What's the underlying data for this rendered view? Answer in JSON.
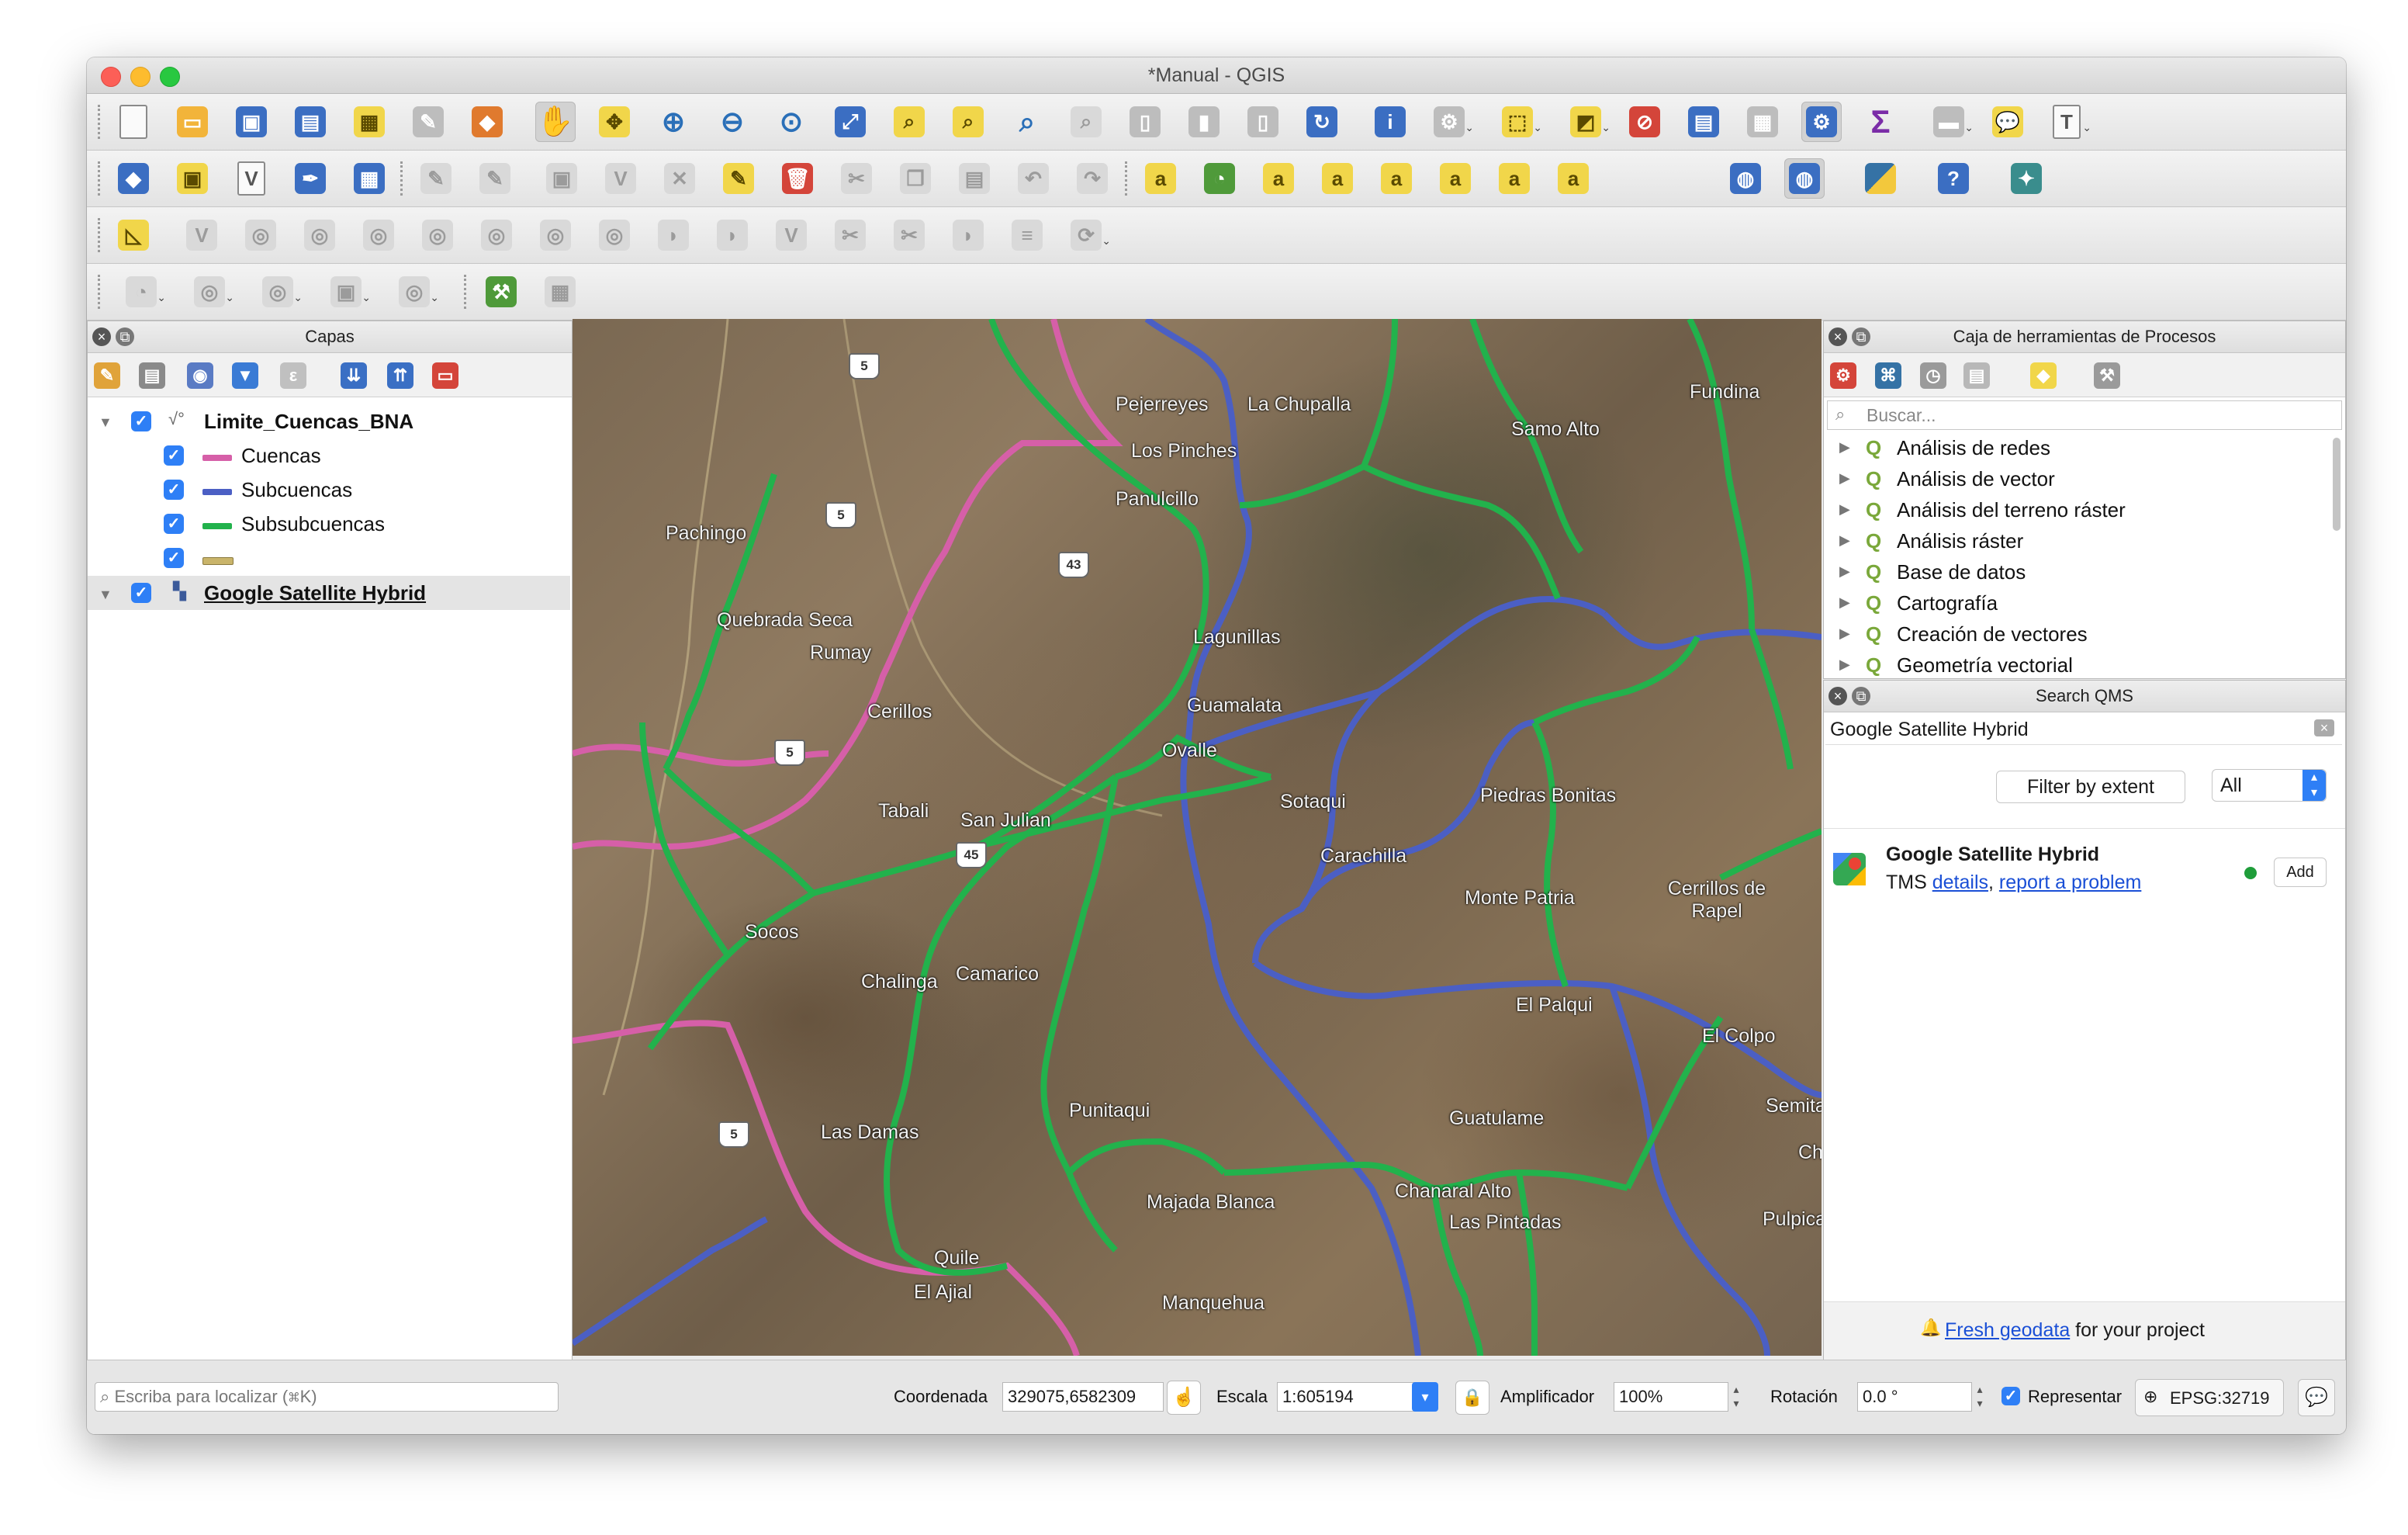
{
  "window": {
    "title": "*Manual - QGIS"
  },
  "toolbars": {
    "row1": [
      "new-project-icon",
      "open-project-icon",
      "save-project-icon",
      "save-as-icon",
      "print-layout-icon",
      "layout-manager-icon",
      "style-manager-icon",
      "pan-icon",
      "pan-to-selection-icon",
      "zoom-in-icon",
      "zoom-out-icon",
      "zoom-native-icon",
      "zoom-full-icon",
      "zoom-selection-icon",
      "zoom-layer-icon",
      "zoom-last-icon",
      "zoom-next-icon",
      "new-bookmark-icon",
      "show-bookmarks-icon",
      "map-tips-icon",
      "refresh-icon",
      "identify-icon",
      "run-action-icon",
      "select-features-icon",
      "select-by-value-icon",
      "deselect-icon",
      "attribute-table-icon",
      "field-calculator-icon",
      "processing-toolbox-icon",
      "statistics-icon",
      "measure-icon",
      "annotation-icon",
      "text-annotation-icon"
    ],
    "row2": [
      "data-source-manager-icon",
      "new-geopackage-icon",
      "new-shapefile-icon",
      "digitize-icon",
      "gps-icon",
      "toggle-editing-icon",
      "current-edits-icon",
      "save-edits-icon",
      "vertex-tool-icon",
      "modify-attributes-icon",
      "delete-selected-icon",
      "cut-features-icon",
      "copy-features-icon",
      "paste-features-icon",
      "undo-icon",
      "redo-icon",
      "label-toolbar-icon",
      "layer-diagram-icon",
      "highlight-pinned-labels-icon",
      "pin-labels-icon",
      "show-hide-labels-icon",
      "move-label-icon",
      "rotate-label-icon",
      "change-label-icon",
      "metasearch-icon",
      "quickmapservices-icon",
      "python-console-icon",
      "help-icon",
      "georeferencer-icon"
    ],
    "row3": [
      "advanced-digitizing-icon",
      "add-ring-icon",
      "add-part-icon",
      "fill-ring-icon",
      "delete-ring-icon",
      "delete-part-icon",
      "reshape-icon",
      "offset-curve-icon",
      "split-features-icon",
      "split-parts-icon",
      "merge-features-icon",
      "merge-attributes-icon",
      "rotate-symbols-icon",
      "simplify-icon",
      "reverse-line-icon",
      "trace-icon"
    ],
    "row4": [
      "add-point-icon",
      "add-line-icon",
      "add-polygon-icon",
      "move-feature-icon",
      "rotate-feature-icon",
      "snapping-icon",
      "select-by-location-icon"
    ]
  },
  "layers_panel": {
    "title": "Capas",
    "tree": [
      {
        "name": "Limite_Cuencas_BNA",
        "checked": true,
        "expanded": true,
        "children": [
          {
            "name": "Cuencas",
            "color": "#d65fa8"
          },
          {
            "name": "Subcuencas",
            "color": "#4b5fc4"
          },
          {
            "name": "Subsubcuencas",
            "color": "#22b24c"
          },
          {
            "name": "",
            "color": "#c9b46a"
          }
        ]
      },
      {
        "name": "Google Satellite Hybrid",
        "checked": true,
        "selected": true
      }
    ]
  },
  "map": {
    "places": [
      "Pejerreyes",
      "La Chupalla",
      "Samo Alto",
      "Fundina",
      "Los Pinches",
      "Panulcillo",
      "Pachingo",
      "Quebrada Seca",
      "Rumay",
      "Cerillos",
      "Lagunillas",
      "Guamalata",
      "Ovalle",
      "Sotaqui",
      "Piedras Bonitas",
      "Tabali",
      "San Julian",
      "Carachilla",
      "Monte Patria",
      "Cerrillos de Rapel",
      "Socos",
      "Chalinga",
      "Camarico",
      "El Palqui",
      "El Colpo",
      "Semita",
      "Guatulame",
      "Punitaqui",
      "Las Damas",
      "Chanaral Alto",
      "Las Pintadas",
      "Majada Blanca",
      "Pulpica",
      "Quile",
      "El Ajial",
      "Manquehua",
      "Ch"
    ],
    "road_shields": [
      "5",
      "5",
      "5",
      "5",
      "43",
      "45"
    ],
    "boundary_colors": {
      "cuencas": "#d65fa8",
      "subcuencas": "#4b5fc4",
      "subsubcuencas": "#22b24c"
    }
  },
  "processing": {
    "title": "Caja de herramientas de Procesos",
    "search_placeholder": "Buscar...",
    "groups": [
      "Análisis de redes",
      "Análisis de vector",
      "Análisis del terreno ráster",
      "Análisis ráster",
      "Base de datos",
      "Cartografía",
      "Creación de vectores",
      "Geometría vectorial"
    ]
  },
  "qms": {
    "title": "Search QMS",
    "query": "Google Satellite Hybrid",
    "filter_button": "Filter by extent",
    "filter_select": "All",
    "result": {
      "name": "Google Satellite Hybrid",
      "type": "TMS",
      "details": "details",
      "report": "report a problem",
      "status_color": "#1f9d3a",
      "add": "Add"
    },
    "footer_link": "Fresh geodata",
    "footer_text": "for your project"
  },
  "status_bar": {
    "locator_placeholder": "Escriba para localizar (⌘K)",
    "coord_label": "Coordenada",
    "coord_value": "329075,6582309",
    "scale_label": "Escala",
    "scale_value": "1:605194",
    "magnifier_label": "Amplificador",
    "magnifier_value": "100%",
    "rotation_label": "Rotación",
    "rotation_value": "0.0 °",
    "render_label": "Representar",
    "crs": "EPSG:32719"
  }
}
